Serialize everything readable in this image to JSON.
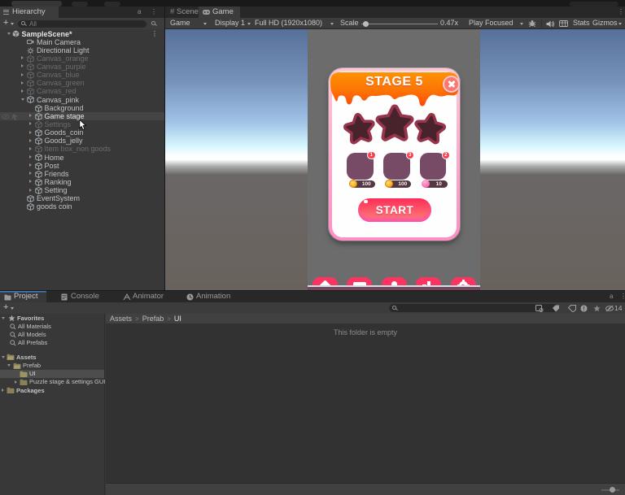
{
  "hierarchy": {
    "tab_label": "Hierarchy",
    "search_placeholder": "All",
    "rows": [
      {
        "label": "SampleScene*",
        "depth": 0,
        "arrow": "open",
        "icon": "scene",
        "bold": true,
        "kebab": true
      },
      {
        "label": "Main Camera",
        "depth": 1,
        "icon": "camera"
      },
      {
        "label": "Directional Light",
        "depth": 1,
        "icon": "light"
      },
      {
        "label": "Canvas_orange",
        "depth": 1,
        "arrow": "closed",
        "icon": "cube",
        "dim": true
      },
      {
        "label": "Canvas_purple",
        "depth": 1,
        "arrow": "closed",
        "icon": "cube",
        "dim": true
      },
      {
        "label": "Canvas_blue",
        "depth": 1,
        "arrow": "closed",
        "icon": "cube",
        "dim": true
      },
      {
        "label": "Canvas_green",
        "depth": 1,
        "arrow": "closed",
        "icon": "cube",
        "dim": true
      },
      {
        "label": "Canvas_red",
        "depth": 1,
        "arrow": "closed",
        "icon": "cube",
        "dim": true
      },
      {
        "label": "Canvas_pink",
        "depth": 1,
        "arrow": "open",
        "icon": "cube"
      },
      {
        "label": "Background",
        "depth": 2,
        "icon": "cube"
      },
      {
        "label": "Game stage",
        "depth": 2,
        "arrow": "closed",
        "icon": "cube",
        "selected": true,
        "cursor": true
      },
      {
        "label": "Settings",
        "depth": 2,
        "arrow": "closed",
        "icon": "cube",
        "dim": true
      },
      {
        "label": "Goods_coin",
        "depth": 2,
        "arrow": "closed",
        "icon": "cube"
      },
      {
        "label": "Goods_jelly",
        "depth": 2,
        "arrow": "closed",
        "icon": "cube"
      },
      {
        "label": "Item box_non goods",
        "depth": 2,
        "arrow": "closed",
        "icon": "cube",
        "dim": true
      },
      {
        "label": "Home",
        "depth": 2,
        "arrow": "closed",
        "icon": "cube"
      },
      {
        "label": "Post",
        "depth": 2,
        "arrow": "closed",
        "icon": "cube"
      },
      {
        "label": "Friends",
        "depth": 2,
        "arrow": "closed",
        "icon": "cube"
      },
      {
        "label": "Ranking",
        "depth": 2,
        "arrow": "closed",
        "icon": "cube"
      },
      {
        "label": "Setting",
        "depth": 2,
        "arrow": "closed",
        "icon": "cube"
      },
      {
        "label": "EventSystem",
        "depth": 1,
        "icon": "cube"
      },
      {
        "label": "goods coin",
        "depth": 1,
        "icon": "cube"
      }
    ]
  },
  "view_tabs": {
    "scene": "Scene",
    "game": "Game"
  },
  "game_toolbar": {
    "camera": "Game",
    "display": "Display 1",
    "resolution": "Full HD (1920x1080)",
    "scale_label": "Scale",
    "scale_value": "0.47x",
    "play_mode": "Play Focused",
    "stats_label": "Stats",
    "gizmos_label": "Gizmos"
  },
  "game_view": {
    "popup": {
      "title": "STAGE 5",
      "stars_total": 3,
      "stars_earned": 0,
      "items": [
        {
          "count_badge": "1",
          "cost": "100",
          "currency": "coin"
        },
        {
          "count_badge": "3",
          "cost": "100",
          "currency": "coin"
        },
        {
          "count_badge": "2",
          "cost": "10",
          "currency": "jelly"
        }
      ],
      "start_label": "START"
    },
    "nav_icons": [
      "home",
      "post",
      "friends",
      "ranking",
      "settings"
    ]
  },
  "project": {
    "tabs": [
      {
        "label": "Project",
        "icon": "folder",
        "active": true
      },
      {
        "label": "Console",
        "icon": "console"
      },
      {
        "label": "Animator",
        "icon": "animator"
      },
      {
        "label": "Animation",
        "icon": "animation"
      }
    ],
    "hidden_count": "14",
    "favorites": {
      "label": "Favorites",
      "items": [
        "All Materials",
        "All Models",
        "All Prefabs"
      ]
    },
    "folders": [
      {
        "label": "Assets",
        "depth": 0,
        "arrow": "open"
      },
      {
        "label": "Prefab",
        "depth": 1,
        "arrow": "open"
      },
      {
        "label": "UI",
        "depth": 2,
        "selected": true
      },
      {
        "label": "Puzzle stage & settings GUI",
        "depth": 2,
        "arrow": "closed"
      },
      {
        "label": "Packages",
        "depth": 0,
        "arrow": "closed"
      }
    ],
    "breadcrumb": [
      "Assets",
      "Prefab",
      "UI"
    ],
    "empty_message": "This folder is empty"
  },
  "colors": {
    "selection_unfocused": "#444444",
    "selection_project": "#4d4d4d",
    "tab_active_line": "#3d7dbf",
    "banner_orange_top": "#fe8501",
    "banner_orange_bottom": "#fc4c08",
    "card_border_top": "#fbcad8",
    "card_border_bottom": "#fd8fc4",
    "star_fill": "#49232b",
    "star_stroke": "#97334a",
    "item_box": "#774a65",
    "price_pill": "#533743",
    "start_top": "#fd2c57",
    "start_bottom": "#fb837b",
    "nav_pink": "#fd3461",
    "viewport_gray": "#6d6c6c"
  }
}
